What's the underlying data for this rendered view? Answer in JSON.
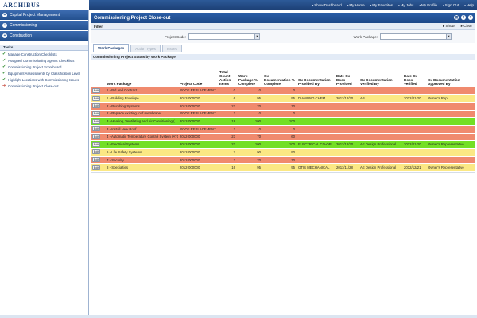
{
  "app": {
    "logo": "ARCHIBUS",
    "top_links": [
      "Show Dashboard",
      "My Home",
      "My Favorites",
      "My Jobs",
      "My Profile",
      "Sign Out",
      "Help"
    ]
  },
  "nav": {
    "sections": [
      "Capital Project Management",
      "Commissioning",
      "Construction"
    ],
    "tasks_title": "Tasks",
    "tasks": [
      {
        "label": "Manage Construction Checklists",
        "icon": "check-icon"
      },
      {
        "label": "Assigned Commissioning Agents Checklists",
        "icon": "check-icon"
      },
      {
        "label": "Commissioning Project Scoreboard",
        "icon": "check-icon"
      },
      {
        "label": "Equipment Assessments by Classification Level",
        "icon": "check-icon"
      },
      {
        "label": "Highlight Locations with Commissioning Issues",
        "icon": "check-icon"
      },
      {
        "label": "Commissioning Project Close-out",
        "icon": "arrow-icon"
      }
    ]
  },
  "panel": {
    "title": "Commissioning Project Close-out",
    "filter_label": "Filter",
    "show_label": "Show",
    "clear_label": "Clear",
    "project_code_label": "Project Code:",
    "work_package_label": "Work Package:",
    "project_code_value": "",
    "work_package_value": ""
  },
  "tabs": [
    "Work Packages",
    "Action Types",
    "Issues"
  ],
  "grid": {
    "title": "Commissioning Project Status by Work Package",
    "edit_label": "Edit",
    "columns": [
      "",
      "Work Package",
      "Project Code",
      "Total Count Action Items",
      "Work Package % Complete",
      "Cx Documentation % Complete",
      "Cx Documentation Provided By",
      "Date Cx Docs Provided",
      "Cx Documentation Verified By",
      "Date Cx Docs Verified",
      "Cx Documentation Approved By"
    ],
    "rows": [
      {
        "status": "red",
        "cells": [
          "1 - Bid and Contract",
          "ROOF REPLACEMENT",
          "0",
          "0",
          "0",
          "",
          "",
          "",
          "",
          ""
        ]
      },
      {
        "status": "yellow",
        "cells": [
          "1 - Building Envelope",
          "2012-000000",
          "6",
          "95",
          "95",
          "DIAMOND CHEM",
          "2011/12/30",
          "AB",
          "2012/01/20",
          "Owner's Rep"
        ]
      },
      {
        "status": "red",
        "cells": [
          "2 - Plumbing Systems",
          "2012-000000",
          "22",
          "70",
          "70",
          "",
          "",
          "",
          "",
          ""
        ]
      },
      {
        "status": "red",
        "cells": [
          "2 - Replace existing roof membrane",
          "ROOF REPLACEMENT",
          "2",
          "0",
          "0",
          "",
          "",
          "",
          "",
          ""
        ]
      },
      {
        "status": "green",
        "cells": [
          "3 - Heating, Ventilating and Air Conditioning (...",
          "2012-000000",
          "18",
          "100",
          "100",
          "",
          "",
          "",
          "",
          ""
        ]
      },
      {
        "status": "red",
        "cells": [
          "3 - Install New Roof",
          "ROOF REPLACEMENT",
          "2",
          "0",
          "0",
          "",
          "",
          "",
          "",
          ""
        ]
      },
      {
        "status": "red",
        "cells": [
          "4 - Automatic Temperature Control System (ATC...",
          "2012-000000",
          "23",
          "70",
          "60",
          "",
          "",
          "",
          "",
          ""
        ]
      },
      {
        "status": "green",
        "cells": [
          "5 - Electrical Systems",
          "2012-000000",
          "22",
          "100",
          "100",
          "ELECTRICAL CO-OP",
          "2011/12/30",
          "AE Design Professional",
          "2012/01/20",
          "Owner's Representative"
        ]
      },
      {
        "status": "yellow",
        "cells": [
          "6 - Life Safety Systems",
          "2012-000000",
          "7",
          "90",
          "90",
          "",
          "",
          "",
          "",
          ""
        ]
      },
      {
        "status": "red",
        "cells": [
          "7 - Security",
          "2012-000000",
          "3",
          "70",
          "70",
          "",
          "",
          "",
          "",
          ""
        ]
      },
      {
        "status": "yellow",
        "cells": [
          "8 - Specialties",
          "2012-000000",
          "16",
          "95",
          "95",
          "OTIS MECHANICAL",
          "2011/11/28",
          "AE Design Professional",
          "2012/12/21",
          "Owner's Representative"
        ]
      }
    ]
  },
  "colors": {
    "red": "#f08a6e",
    "yellow": "#fbe884",
    "green": "#73df24",
    "header_blue": "#1f4a88"
  }
}
